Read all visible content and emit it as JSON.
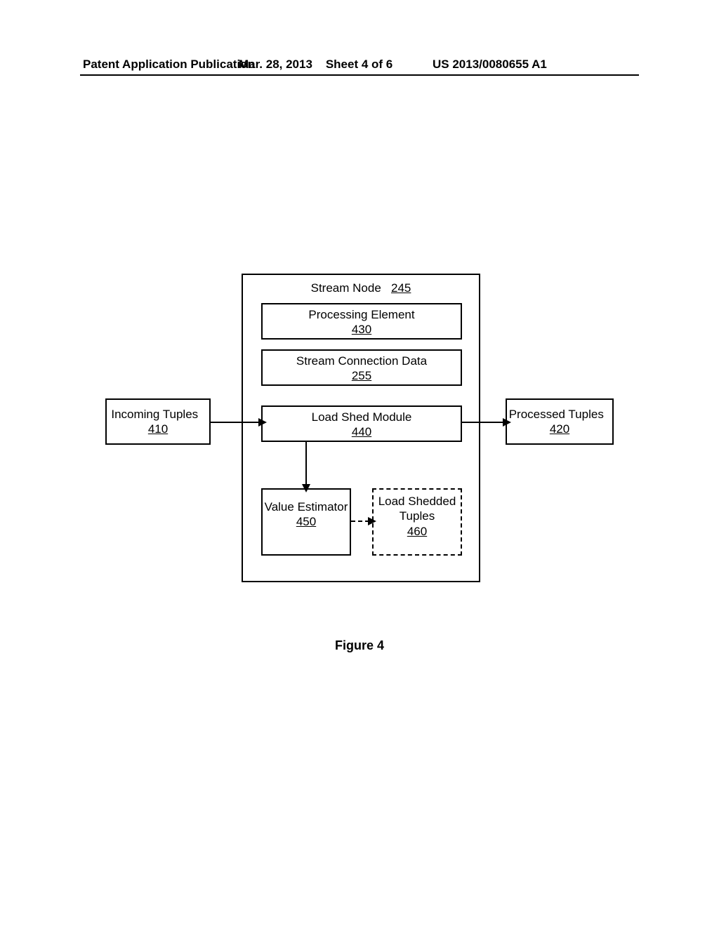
{
  "header": {
    "left": "Patent Application Publication",
    "mid_date": "Mar. 28, 2013",
    "mid_sheet": "Sheet 4 of 6",
    "right": "US 2013/0080655 A1"
  },
  "figure_caption": "Figure 4",
  "nodes": {
    "incoming": {
      "label": "Incoming Tuples",
      "ref": "410"
    },
    "processed": {
      "label": "Processed Tuples",
      "ref": "420"
    },
    "stream_node": {
      "label": "Stream Node",
      "ref": "245"
    },
    "processing_element": {
      "label": "Processing Element",
      "ref": "430"
    },
    "stream_conn_data": {
      "label": "Stream Connection Data",
      "ref": "255"
    },
    "load_shed_module": {
      "label": "Load Shed Module",
      "ref": "440"
    },
    "value_estimator": {
      "label": "Value Estimator",
      "ref": "450"
    },
    "load_shedded_tuples": {
      "label": "Load Shedded Tuples",
      "ref": "460"
    }
  }
}
